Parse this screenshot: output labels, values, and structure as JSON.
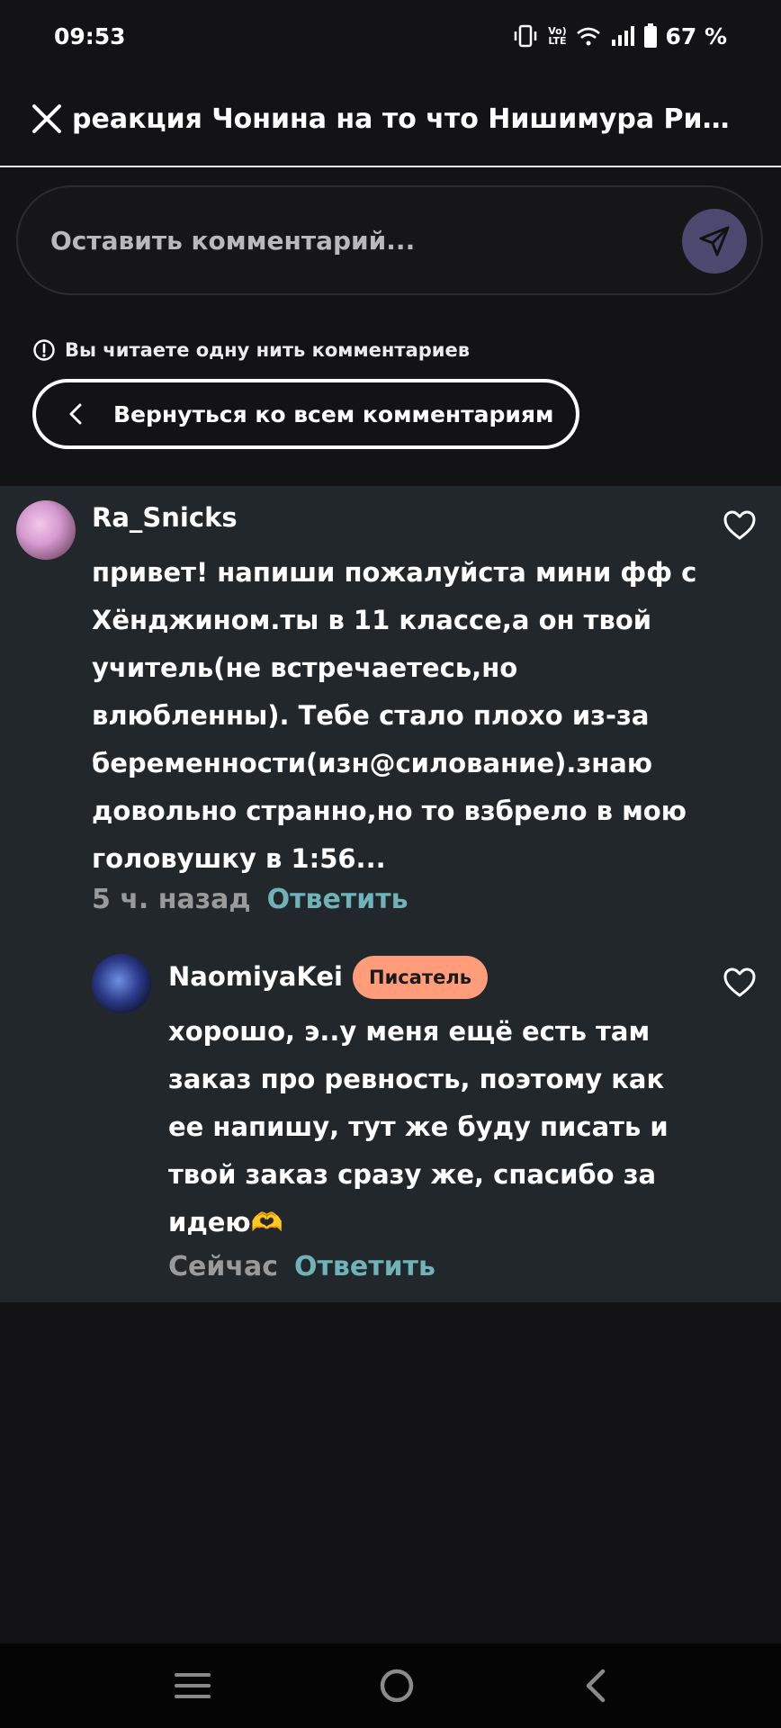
{
  "status_bar": {
    "time": "09:53",
    "network_label": "Vo) LTE",
    "battery": "67 %"
  },
  "header": {
    "title": "реакция Чонина на то что Нишимура Рик..."
  },
  "composer": {
    "placeholder": "Оставить комментарий..."
  },
  "thread_notice": "Вы читаете одну нить комментариев",
  "back_button_label": "Вернуться ко всем комментариям",
  "comments": [
    {
      "author": "Ra_Snicks",
      "text": "привет! напиши пожалуйста мини фф с Хёнджином.ты в 11 классе,а он твой учитель(не встречаетесь,но влюбленны). Тебе стало плохо из-за беременности(изн@силование).знаю довольно странно,но то взбрело в мою головушку в 1:56...",
      "time": "5 ч. назад",
      "reply_label": "Ответить"
    },
    {
      "author": "NaomiyaKei",
      "badge": "Писатель",
      "text": "хорошо, э..у меня ещё есть там заказ про ревность, поэтому как ее напишу, тут же буду писать и твой заказ сразу же, спасибо за идею🫶",
      "time": "Сейчас",
      "reply_label": "Ответить"
    }
  ],
  "icons": {
    "close": "close-icon",
    "send": "send-icon",
    "info": "info-icon",
    "chevron": "chevron-left-icon",
    "heart": "heart-icon",
    "menu": "menu-icon",
    "home": "home-icon",
    "back": "back-icon"
  },
  "colors": {
    "background": "#131315",
    "thread_background": "#21272a",
    "send_button": "#4c4870",
    "badge": "#ff9d7a",
    "reply_link": "#6fb2b7",
    "time_text": "#9a9a9a"
  }
}
